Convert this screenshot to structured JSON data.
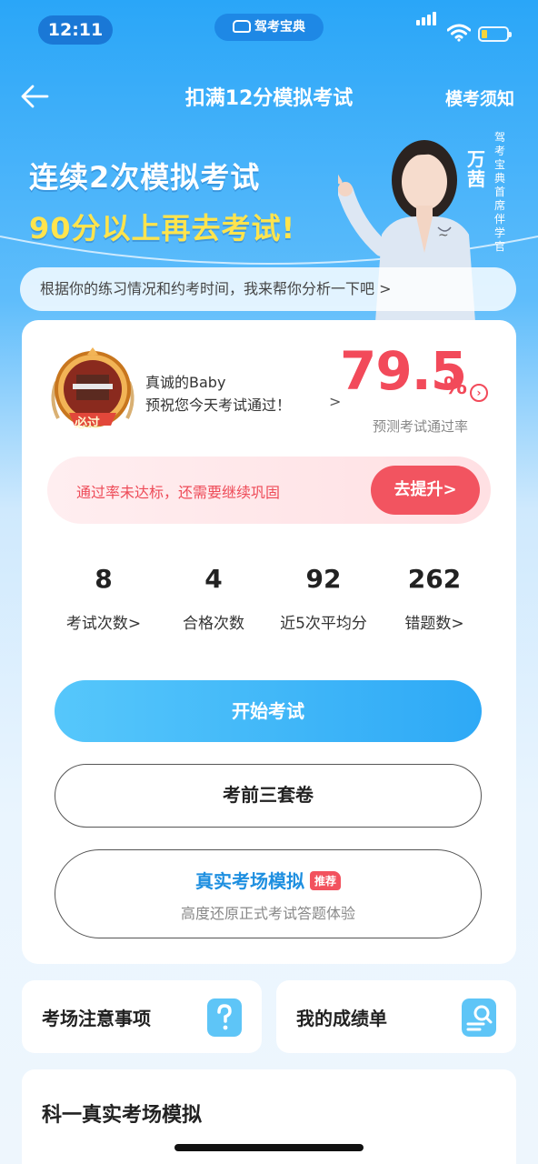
{
  "status_bar": {
    "time": "12:11",
    "app_badge": "驾考宝典"
  },
  "nav": {
    "title": "扣满12分模拟考试",
    "right_link": "模考须知"
  },
  "banner": {
    "line1": "连续2次模拟考试",
    "line2": "90分以上再去考试!",
    "presenter_name": "万茜",
    "presenter_role": "驾考宝典首席伴学官"
  },
  "analysis_prompt": "根据你的练习情况和约考时间，我来帮你分析一下吧 >",
  "prediction": {
    "badge_text": "必过",
    "user_name": "真诚的Baby",
    "message": "预祝您今天考试通过！",
    "arrow": ">",
    "pass_rate": "79.5",
    "pass_rate_unit": "%",
    "pass_rate_label": "预测考试通过率",
    "pass_rate_color": "#f24a5a"
  },
  "notice": {
    "text": "通过率未达标，还需要继续巩固",
    "button": "去提升>"
  },
  "stats": [
    {
      "value": "8",
      "label": "考试次数>"
    },
    {
      "value": "4",
      "label": "合格次数"
    },
    {
      "value": "92",
      "label": "近5次平均分"
    },
    {
      "value": "262",
      "label": "错题数>"
    }
  ],
  "actions": {
    "start": "开始考试",
    "papers": "考前三套卷",
    "real_sim_title": "真实考场模拟",
    "real_sim_tag": "推荐",
    "real_sim_sub": "高度还原正式考试答题体验"
  },
  "tiles": [
    {
      "label": "考场注意事项",
      "icon": "question-icon"
    },
    {
      "label": "我的成绩单",
      "icon": "report-search-icon"
    }
  ],
  "bottom_card": {
    "title": "科一真实考场模拟"
  },
  "colors": {
    "accent": "#2ea9f6",
    "danger": "#f24a5a",
    "highlight": "#ffe44d"
  }
}
